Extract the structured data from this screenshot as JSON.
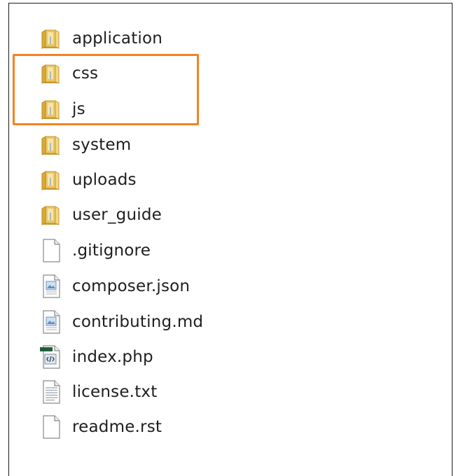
{
  "explorer": {
    "items": [
      {
        "name": "application",
        "type": "folder",
        "icon": "folder-icon"
      },
      {
        "name": "css",
        "type": "folder",
        "icon": "folder-icon"
      },
      {
        "name": "js",
        "type": "folder",
        "icon": "folder-icon"
      },
      {
        "name": "system",
        "type": "folder",
        "icon": "folder-icon"
      },
      {
        "name": "uploads",
        "type": "folder",
        "icon": "folder-icon"
      },
      {
        "name": "user_guide",
        "type": "folder",
        "icon": "folder-icon"
      },
      {
        "name": ".gitignore",
        "type": "file",
        "icon": "blank-file-icon"
      },
      {
        "name": "composer.json",
        "type": "file",
        "icon": "document-file-icon"
      },
      {
        "name": "contributing.md",
        "type": "file",
        "icon": "document-file-icon"
      },
      {
        "name": "index.php",
        "type": "file",
        "icon": "php-file-icon"
      },
      {
        "name": "license.txt",
        "type": "file",
        "icon": "text-file-icon"
      },
      {
        "name": "readme.rst",
        "type": "file",
        "icon": "blank-file-icon"
      }
    ]
  },
  "highlight": {
    "color": "#f58220",
    "items": [
      "css",
      "js"
    ]
  }
}
